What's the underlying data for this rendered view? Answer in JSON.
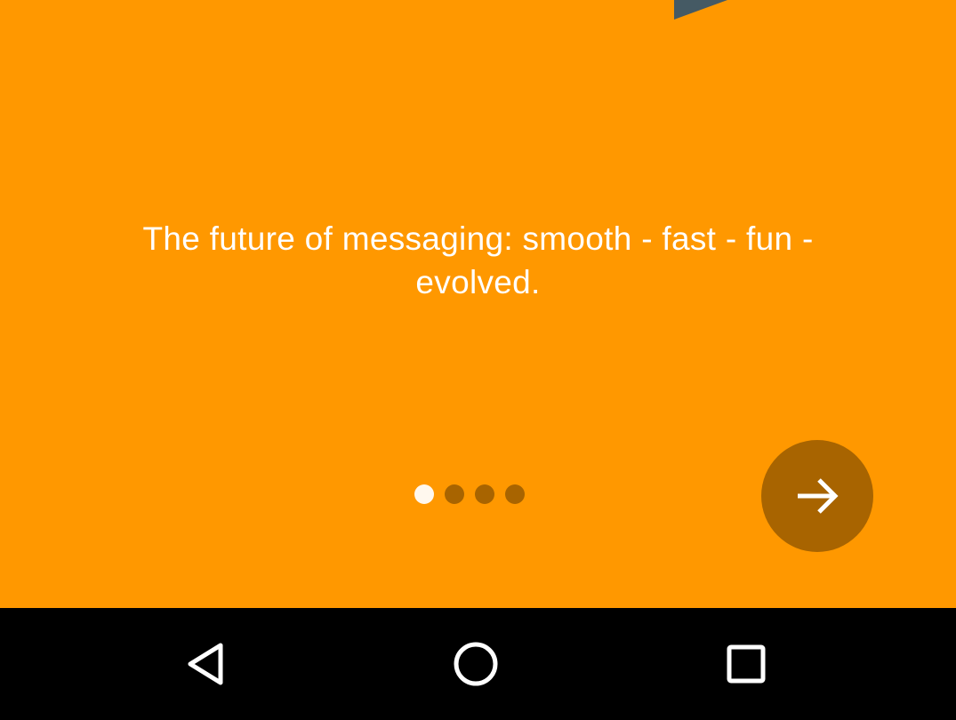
{
  "intro": {
    "tagline": "The future of messaging: smooth - fast - fun - evolved.",
    "page_count": 4,
    "current_page": 1,
    "next_icon": "arrow-right-icon"
  },
  "colors": {
    "background": "#ff9800",
    "accent_dark": "#a86400",
    "dot_active": "#fff8ee",
    "text": "#ffffff",
    "nav_bar": "#000000",
    "corner_shape": "#455a64"
  },
  "nav_bar": {
    "icons": [
      "back-icon",
      "home-icon",
      "recents-icon"
    ]
  }
}
